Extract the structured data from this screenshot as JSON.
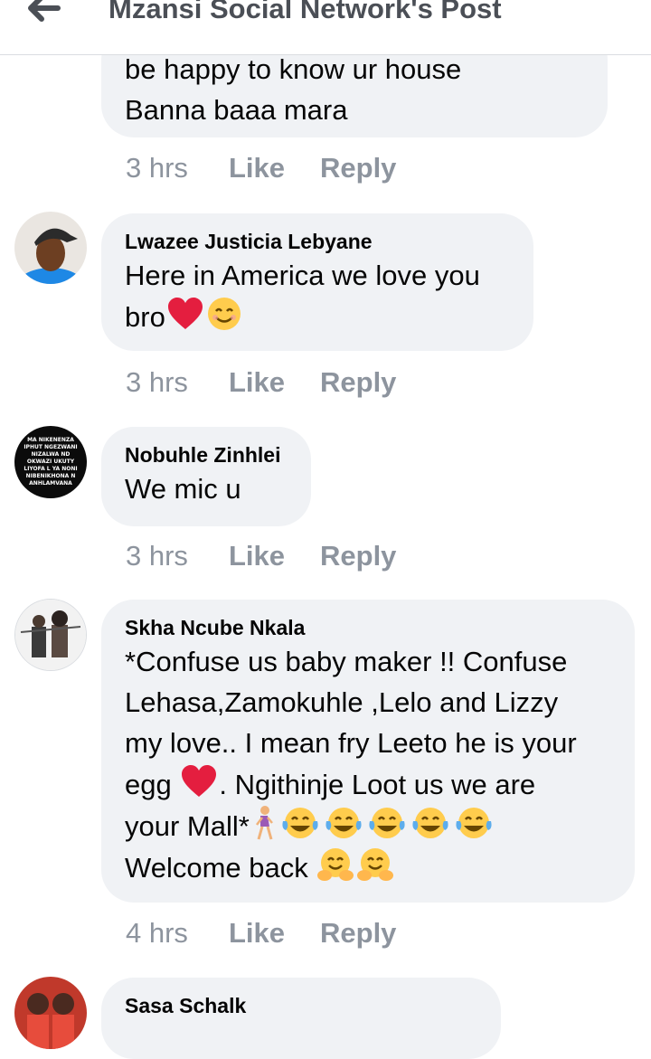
{
  "header": {
    "title": "Mzansi Social Network's Post",
    "back_icon": "arrow-left-icon"
  },
  "comments": [
    {
      "name": "",
      "lines": [
        "be happy to know ur house",
        "Banna baaa mara"
      ],
      "time": "3 hrs",
      "like": "Like",
      "reply": "Reply"
    },
    {
      "name": "Lwazee Justicia Lebyane",
      "line1": "Here in America we love you",
      "line2_text": "bro",
      "emojis": [
        "red-heart",
        "smiling-face"
      ],
      "time": "3 hrs",
      "like": "Like",
      "reply": "Reply"
    },
    {
      "name": "Nobuhle Zinhlei",
      "avatar_text": "MA NIKENENZA IPHUT NGEZWANI NIZALWA ND OKWAZI UKUTY LIYOFA L YA NONI NIBENIKHONA N ANHLAMVANA",
      "line1": "We mic u",
      "time": "3 hrs",
      "like": "Like",
      "reply": "Reply"
    },
    {
      "name": "Skha Ncube Nkala",
      "line1": "*Confuse us baby maker !! Confuse",
      "line2": "Lehasa,Zamokuhle ,Lelo and Lizzy",
      "line3": "my love.. I mean fry Leeto he is your",
      "line4a": "egg",
      "line4b": ". Ngithinje Loot us we are",
      "line5": "your Mall*",
      "line6": "Welcome back",
      "emojis": [
        "red-heart",
        "woman-walking",
        "tears-of-joy-x5",
        "hugging-face-x2"
      ],
      "time": "4 hrs",
      "like": "Like",
      "reply": "Reply"
    },
    {
      "name": "Sasa Schalk"
    }
  ],
  "colors": {
    "bubble": "#f0f2f5",
    "meta": "#8d949e",
    "title": "#4b4f56",
    "heart": "#e41e3f",
    "emoji": "#ffcc4d"
  }
}
